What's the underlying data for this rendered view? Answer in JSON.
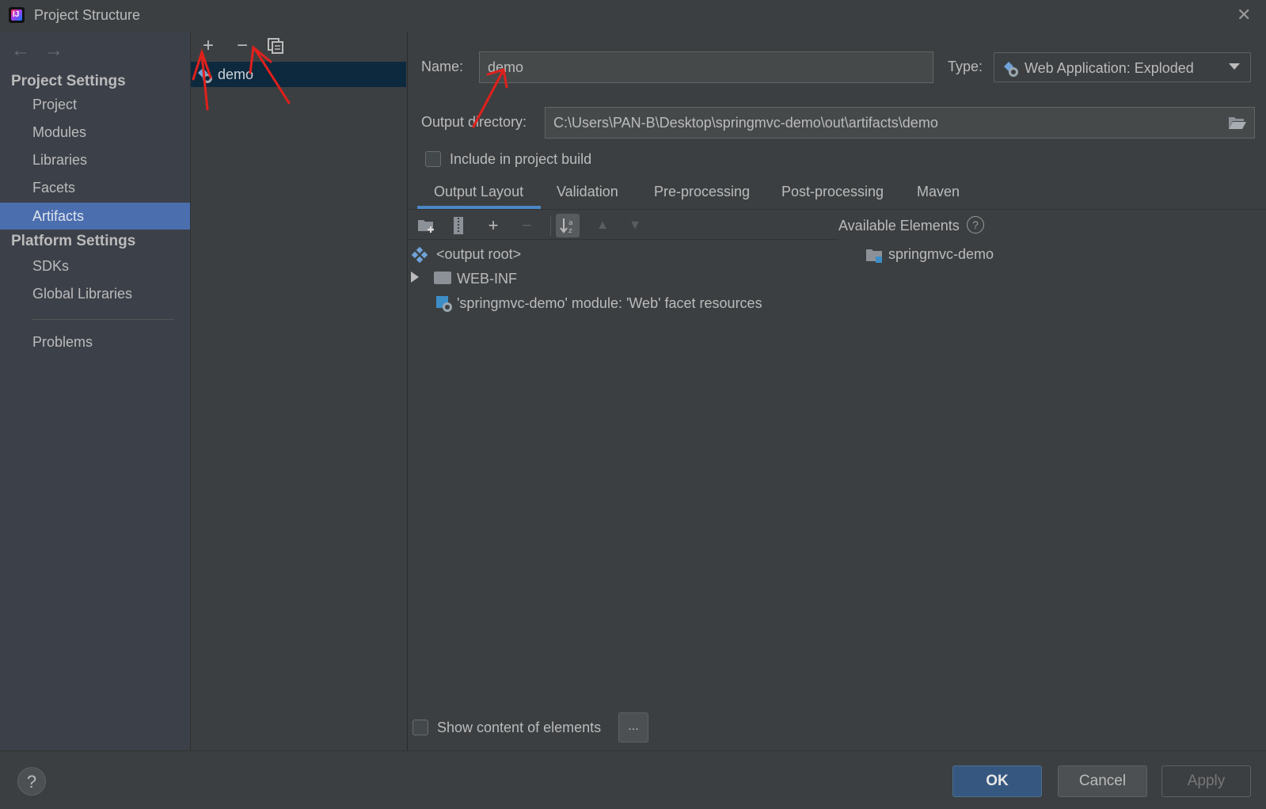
{
  "window": {
    "title": "Project Structure"
  },
  "sidebar": {
    "project_settings_header": "Project Settings",
    "project_items": [
      "Project",
      "Modules",
      "Libraries",
      "Facets",
      "Artifacts"
    ],
    "selected": "Artifacts",
    "platform_settings_header": "Platform Settings",
    "platform_items": [
      "SDKs",
      "Global Libraries"
    ],
    "problems": "Problems"
  },
  "artifacts_list": {
    "items": [
      "demo"
    ]
  },
  "artifact": {
    "name_label": "Name:",
    "name_value": "demo",
    "type_label": "Type:",
    "type_value": "Web Application: Exploded",
    "output_dir_label": "Output directory:",
    "output_dir_value": "C:\\Users\\PAN-B\\Desktop\\springmvc-demo\\out\\artifacts\\demo",
    "include_in_build_label": "Include in project build",
    "include_in_build_checked": false
  },
  "tabs": [
    "Output Layout",
    "Validation",
    "Pre-processing",
    "Post-processing",
    "Maven"
  ],
  "active_tab": "Output Layout",
  "layout_tree": {
    "output_root": "<output root>",
    "web_inf": "WEB-INF",
    "facet_resources": "'springmvc-demo' module: 'Web' facet resources"
  },
  "available_elements": {
    "header": "Available Elements",
    "items": [
      "springmvc-demo"
    ]
  },
  "show_content": {
    "label": "Show content of elements",
    "button": "...",
    "checked": false
  },
  "buttons": {
    "ok": "OK",
    "cancel": "Cancel",
    "apply": "Apply",
    "help": "?"
  },
  "colors": {
    "accent": "#4b6eaf",
    "selection": "#0d293e",
    "annotation": "#e0201c"
  }
}
